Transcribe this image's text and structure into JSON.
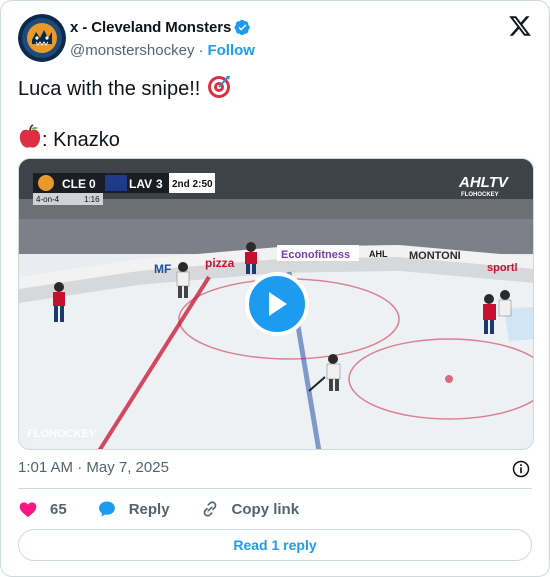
{
  "author": {
    "display_name": "x - Cleveland Monsters",
    "handle": "@monstershockey",
    "separator": "·",
    "follow_label": "Follow",
    "avatar_text": "CLEVELAND MONSTERS"
  },
  "tweet": {
    "line1": "Luca with the snipe!! ",
    "line2": ": Knazko",
    "emoji_line1": "direct-hit-icon",
    "emoji_line2": "apple-icon"
  },
  "video": {
    "scorebug": {
      "team_home": "CLE",
      "score_home": "0",
      "team_away": "LAV",
      "score_away": "3",
      "period_time": "2nd 2:50",
      "strength": "4-on-4",
      "strength_time": "1:16"
    },
    "network_logo": "AHLTV",
    "network_sub": "FLOHOCKEY",
    "watermark": "FLOHOCKEY",
    "boards": [
      "Econofitness",
      "AHL",
      "MONTONI",
      "pizza",
      "MF",
      "sportl"
    ]
  },
  "meta": {
    "timestamp": "1:01 AM · May 7, 2025"
  },
  "actions": {
    "like_count": "65",
    "reply_label": "Reply",
    "copy_label": "Copy link"
  },
  "read_replies_label": "Read 1 reply",
  "colors": {
    "brand_blue": "#1d9bf0",
    "like_pink": "#f91880",
    "text_secondary": "#536471",
    "border": "#cfd9de"
  }
}
